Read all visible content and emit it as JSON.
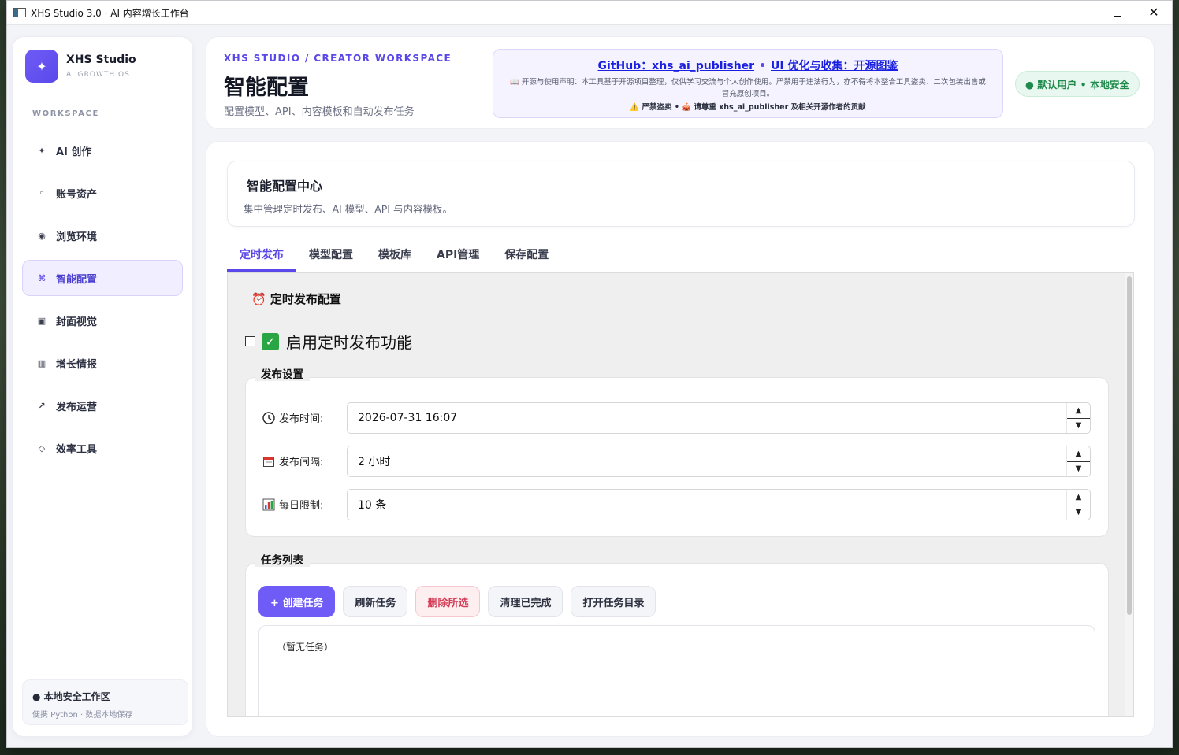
{
  "window": {
    "title": "XHS Studio 3.0 · AI 内容增长工作台"
  },
  "sidebar": {
    "brand_name": "XHS Studio",
    "brand_sub": "AI GROWTH OS",
    "section_label": "WORKSPACE",
    "items": [
      {
        "label": "AI 创作",
        "icon": "sparkle-icon",
        "glyph": "✦"
      },
      {
        "label": "账号资产",
        "icon": "dot-icon",
        "glyph": "◦"
      },
      {
        "label": "浏览环境",
        "icon": "globe-icon",
        "glyph": "◉"
      },
      {
        "label": "智能配置",
        "icon": "command-icon",
        "glyph": "⌘"
      },
      {
        "label": "封面视觉",
        "icon": "image-icon",
        "glyph": "▣"
      },
      {
        "label": "增长情报",
        "icon": "chart-icon",
        "glyph": "▥"
      },
      {
        "label": "发布运营",
        "icon": "arrow-icon",
        "glyph": "↗"
      },
      {
        "label": "效率工具",
        "icon": "diamond-icon",
        "glyph": "◇"
      }
    ],
    "active_index": 3,
    "footer_title": "● 本地安全工作区",
    "footer_sub": "便携 Python · 数据本地保存"
  },
  "header": {
    "eyebrow": "XHS STUDIO / CREATOR WORKSPACE",
    "title": "智能配置",
    "desc": "配置模型、API、内容模板和自动发布任务",
    "link1": "GitHub：xhs_ai_publisher",
    "link_sep": "•",
    "link2": "UI 优化与收集：开源图鉴",
    "notice_text": "📖 开源与使用声明：本工具基于开源项目整理，仅供学习交流与个人创作使用。严禁用于违法行为，亦不得将本整合工具盗卖、二次包装出售或冒充原创项目。",
    "notice_bold": "⚠️ 严禁盗卖 • 🎪 请尊重 xhs_ai_publisher 及相关开源作者的贡献",
    "user_badge": "● 默认用户 • 本地安全"
  },
  "config_card": {
    "title": "智能配置中心",
    "subtitle": "集中管理定时发布、AI 模型、API 与内容模板。"
  },
  "tabs": [
    "定时发布",
    "模型配置",
    "模板库",
    "API管理",
    "保存配置"
  ],
  "schedule": {
    "section_title": "⏰ 定时发布配置",
    "enable_label": "启用定时发布功能",
    "enable_checked": false,
    "publish_group": "发布设置",
    "fields": [
      {
        "icon": "clock-icon",
        "glyph": "🕘",
        "label": "发布时间:",
        "value": "2026-07-31 16:07"
      },
      {
        "icon": "calendar-icon",
        "glyph": "📅",
        "label": "发布间隔:",
        "value": "2 小时"
      },
      {
        "icon": "bar-chart-icon",
        "glyph": "📊",
        "label": "每日限制:",
        "value": "10 条"
      }
    ],
    "task_group": "任务列表",
    "buttons": {
      "create": "+ 创建任务",
      "refresh": "刷新任务",
      "delete": "删除所选",
      "clear": "清理已完成",
      "open_dir": "打开任务目录"
    },
    "empty_text": "（暂无任务）"
  }
}
